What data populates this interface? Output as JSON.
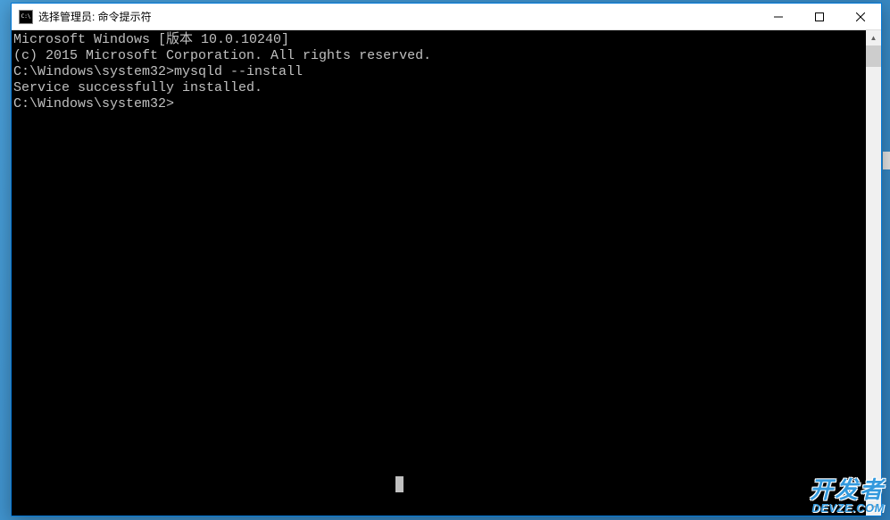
{
  "window": {
    "title": "选择管理员: 命令提示符"
  },
  "terminal": {
    "line1": "Microsoft Windows [版本 10.0.10240]",
    "line2": "(c) 2015 Microsoft Corporation. All rights reserved.",
    "blank1": "",
    "prompt1": "C:\\Windows\\system32>mysqld --install",
    "result1": "Service successfully installed.",
    "blank2": "",
    "prompt2": "C:\\Windows\\system32>"
  },
  "watermark": {
    "line1": "开发者",
    "line2": "DEVZE.COM"
  }
}
